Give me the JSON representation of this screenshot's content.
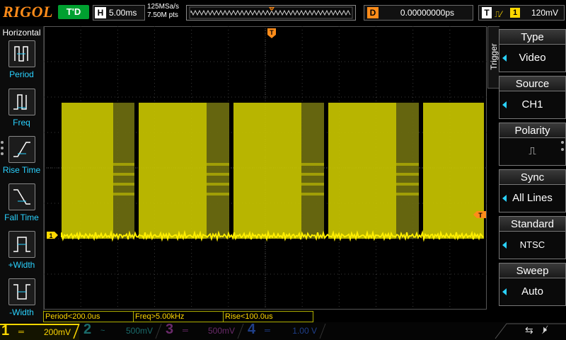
{
  "brand": "RIGOL",
  "topbar": {
    "run_status": "T'D",
    "timebase_key": "H",
    "timebase_value": "5.00ms",
    "sample_rate": "125MSa/s",
    "memory_depth": "7.50M pts",
    "delay_key": "D",
    "delay_value": "0.00000000ps",
    "trigger_key": "T",
    "trigger_source_badge": "1",
    "trigger_level": "120mV"
  },
  "left_panel": {
    "title": "Horizontal",
    "items": [
      {
        "label": "Period",
        "icon": "period-measure-icon"
      },
      {
        "label": "Freq",
        "icon": "frequency-measure-icon"
      },
      {
        "label": "Rise Time",
        "icon": "rise-time-icon"
      },
      {
        "label": "Fall Time",
        "icon": "fall-time-icon"
      },
      {
        "label": "+Width",
        "icon": "positive-width-icon"
      },
      {
        "label": "-Width",
        "icon": "negative-width-icon"
      }
    ]
  },
  "right_panel": {
    "tab_label": "Trigger",
    "menu": [
      {
        "title": "Type",
        "value": "Video"
      },
      {
        "title": "Source",
        "value": "CH1"
      },
      {
        "title": "Polarity",
        "value": "⎍"
      },
      {
        "title": "Sync",
        "value": "All Lines"
      },
      {
        "title": "Standard",
        "value": "NTSC"
      },
      {
        "title": "Sweep",
        "value": "Auto"
      }
    ]
  },
  "plot": {
    "trigger_marker": "T",
    "channel_marker": "1",
    "trigger_level_marker": "T"
  },
  "measurements": [
    {
      "text": "Period<200.0us"
    },
    {
      "text": "Freq>5.00kHz"
    },
    {
      "text": "Rise<100.0us"
    }
  ],
  "channels": [
    {
      "num": "1",
      "coupling": "═",
      "scale": "200mV",
      "color": "#ffd800",
      "active": true
    },
    {
      "num": "2",
      "coupling": "~",
      "scale": "500mV",
      "color": "#1a6a6a",
      "active": false
    },
    {
      "num": "3",
      "coupling": "═",
      "scale": "500mV",
      "color": "#6a2a6a",
      "active": false
    },
    {
      "num": "4",
      "coupling": "═",
      "scale": "1.00 V",
      "color": "#1f3f8a",
      "active": false
    }
  ],
  "colors": {
    "trace": "#c8c400",
    "trace_dark": "#6a6a10",
    "accent_orange": "#ff8c1a",
    "menu_arrow": "#2ad2ff"
  }
}
